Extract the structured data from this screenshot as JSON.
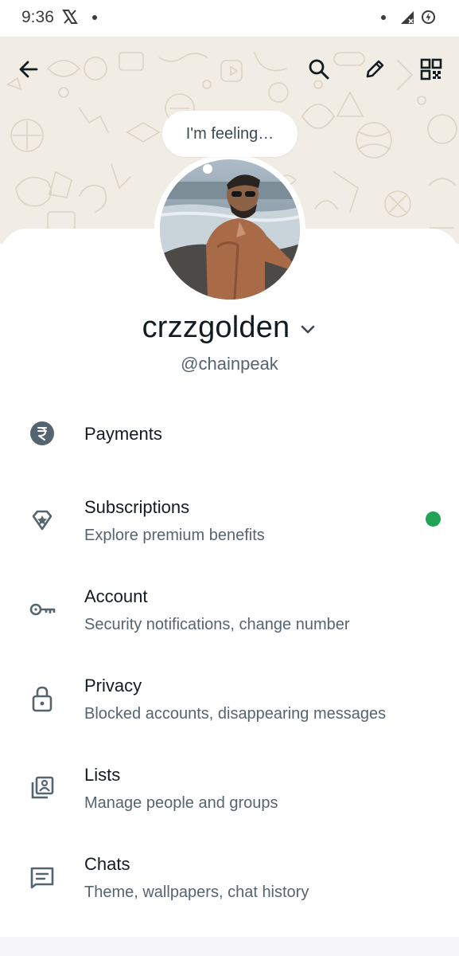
{
  "status_bar": {
    "time": "9:36",
    "icons": [
      "x-logo-icon",
      "notification-dot-icon",
      "signal-icon",
      "battery-saver-icon"
    ]
  },
  "header": {
    "icons": [
      "back-arrow-icon",
      "search-icon",
      "edit-pencil-icon",
      "qr-code-icon"
    ],
    "background": "#f1ede4"
  },
  "profile": {
    "feeling_prompt": "I'm feeling…",
    "name": "crzzgolden",
    "username": "@chainpeak"
  },
  "menu": {
    "items": [
      {
        "title": "Payments",
        "subtitle": "",
        "icon": "rupee-icon"
      },
      {
        "title": "Subscriptions",
        "subtitle": "Explore premium benefits",
        "icon": "badge-star-icon",
        "indicator_color": "#21a354"
      },
      {
        "title": "Account",
        "subtitle": "Security notifications, change number",
        "icon": "key-icon"
      },
      {
        "title": "Privacy",
        "subtitle": "Blocked accounts, disappearing messages",
        "icon": "lock-icon"
      },
      {
        "title": "Lists",
        "subtitle": "Manage people and groups",
        "icon": "lists-icon"
      },
      {
        "title": "Chats",
        "subtitle": "Theme, wallpapers, chat history",
        "icon": "chat-icon"
      }
    ]
  },
  "colors": {
    "text_primary": "#111b21",
    "text_secondary": "#54656f",
    "accent_green": "#21a354"
  }
}
